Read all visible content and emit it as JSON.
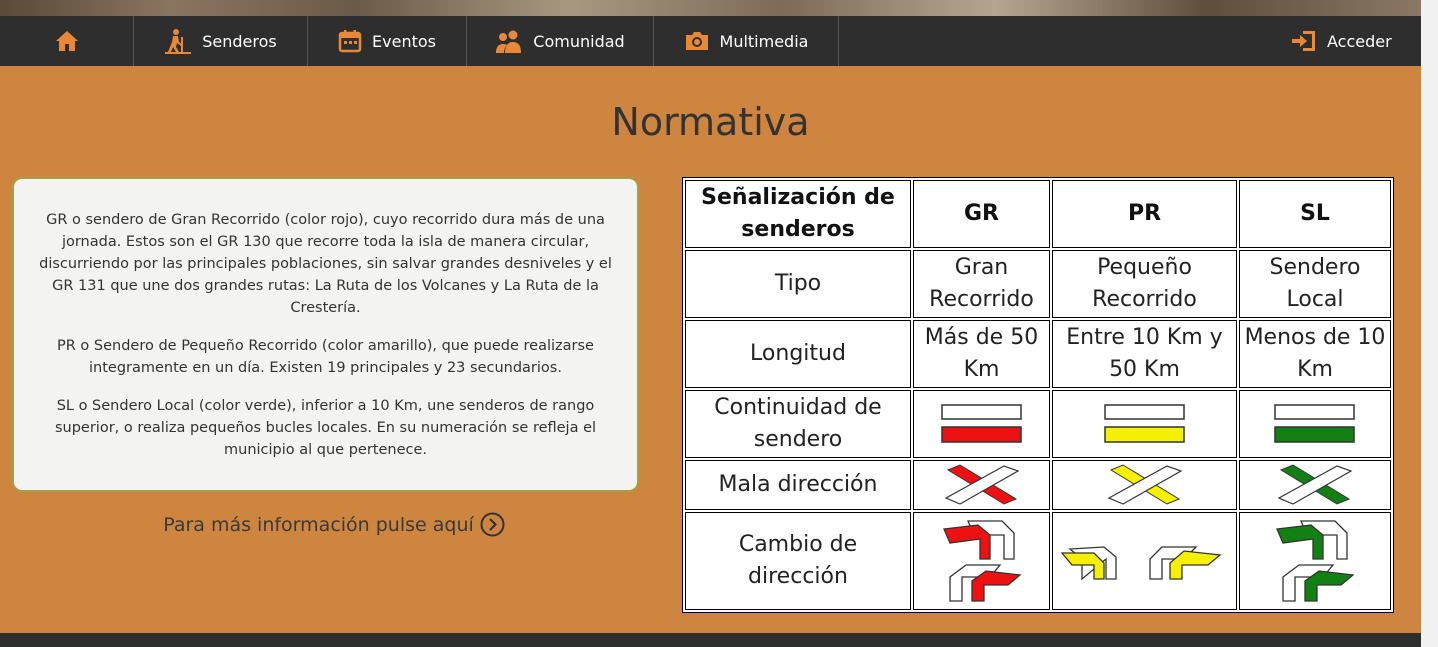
{
  "nav": {
    "home_icon": "home-icon",
    "items": [
      {
        "label": "Senderos",
        "icon": "hiker-icon"
      },
      {
        "label": "Eventos",
        "icon": "calendar-icon"
      },
      {
        "label": "Comunidad",
        "icon": "people-icon"
      },
      {
        "label": "Multimedia",
        "icon": "camera-icon"
      }
    ],
    "login": {
      "label": "Acceder",
      "icon": "login-icon"
    }
  },
  "page": {
    "title": "Normativa",
    "paragraphs": [
      "GR o sendero de Gran Recorrido (color rojo), cuyo recorrido dura más de una jornada. Estos son el GR 130 que recorre toda la isla de manera circular, discurriendo por las principales poblaciones, sin salvar grandes desniveles y el GR 131 que une dos grandes rutas: La Ruta de los Volcanes y La Ruta de la Crestería.",
      "PR o Sendero de Pequeño Recorrido (color amarillo), que puede realizarse integramente en un día. Existen 19 principales y 23 secundarios.",
      "SL o Sendero Local (color verde), inferior a 10 Km, une senderos de rango superior, o realiza pequeños bucles locales. En su numeración se refleja el municipio al que pertenece."
    ],
    "more_link": "Para más información pulse aquí"
  },
  "table": {
    "header": [
      "Señalización de senderos",
      "GR",
      "PR",
      "SL"
    ],
    "rows": [
      {
        "label": "Tipo",
        "values": [
          "Gran Recorrido",
          "Pequeño Recorrido",
          "Sendero Local"
        ]
      },
      {
        "label": "Longitud",
        "values": [
          "Más de 50 Km",
          "Entre 10 Km y 50 Km",
          "Menos de 10 Km"
        ]
      },
      {
        "label": "Continuidad de sendero"
      },
      {
        "label": "Mala dirección"
      },
      {
        "label": "Cambio de dirección"
      }
    ],
    "colors": {
      "GR": "#ee1111",
      "PR": "#f5f000",
      "SL": "#128012"
    }
  },
  "colors": {
    "background": "#cd853f",
    "nav": "#2e2e2e",
    "nav_text": "#ffffff"
  }
}
